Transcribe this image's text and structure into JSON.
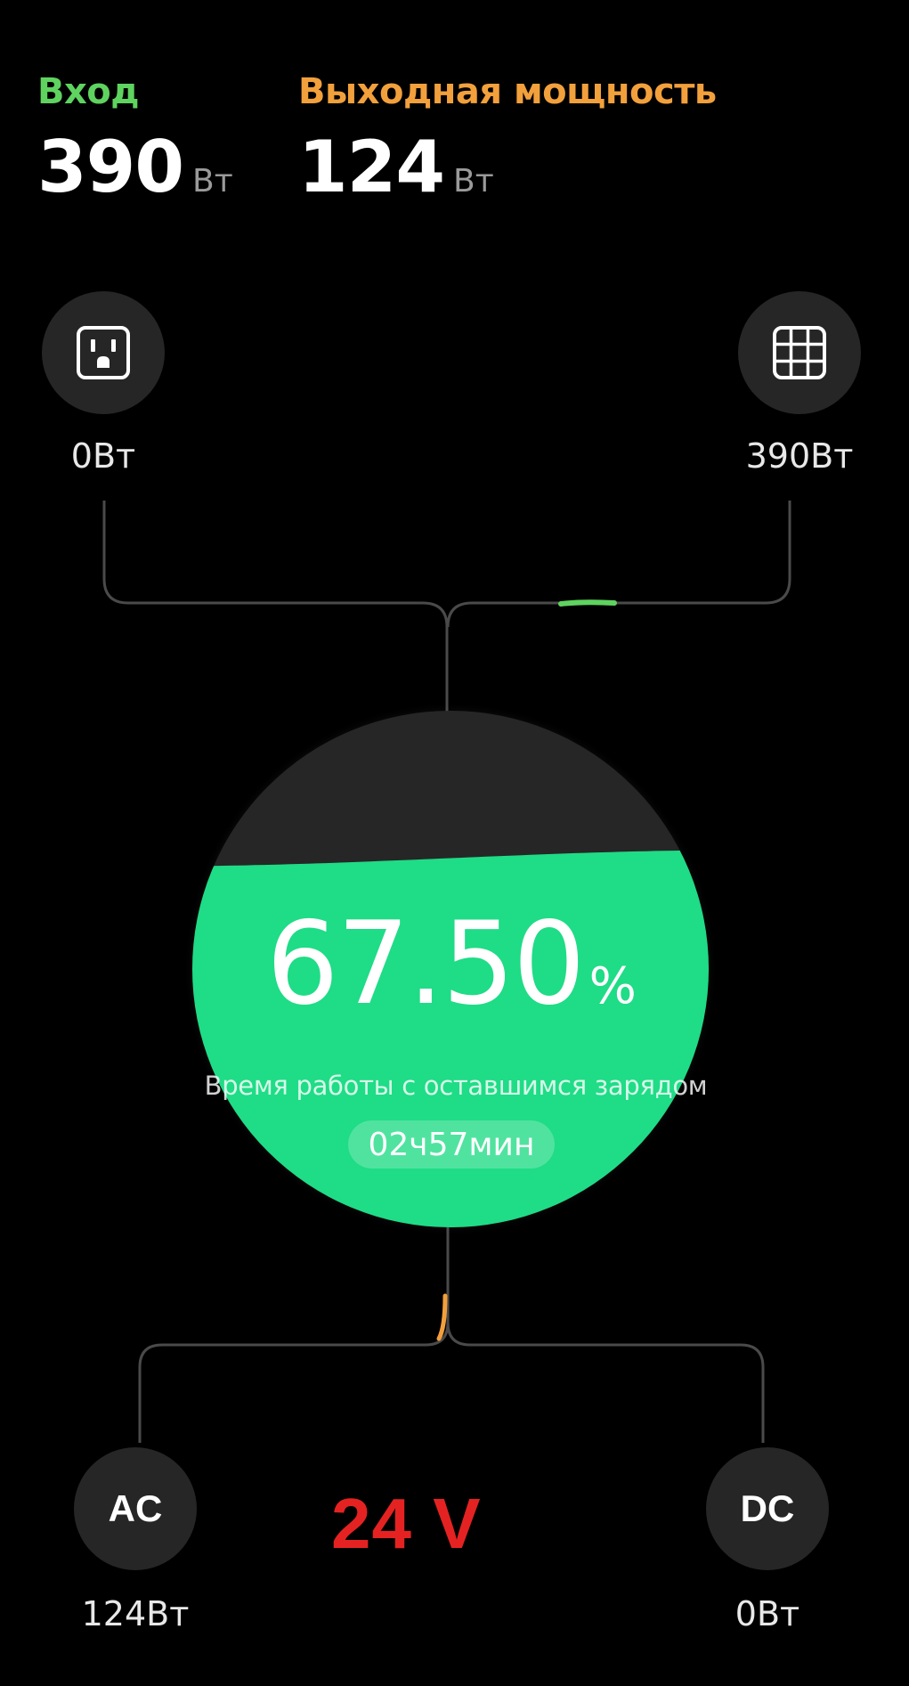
{
  "header": {
    "input_label": "Вход",
    "input_value": "390",
    "input_unit": "Вт",
    "output_label": "Выходная мощность",
    "output_value": "124",
    "output_unit": "Вт"
  },
  "sources": {
    "grid": {
      "icon": "outlet-icon",
      "value": "0Вт"
    },
    "solar": {
      "icon": "solar-panel-icon",
      "value": "390Вт"
    }
  },
  "battery": {
    "percent": "67.50",
    "percent_sign": "%",
    "level": 0.675,
    "runtime_label": "Время работы с оставшимся зарядом",
    "runtime_value": "02ч57мин"
  },
  "outputs": {
    "ac": {
      "label": "AC",
      "value": "124Вт"
    },
    "dc": {
      "label": "DC",
      "value": "0Вт"
    }
  },
  "voltage": "24 V",
  "colors": {
    "input": "#5fd35f",
    "output": "#f2a03c",
    "battery_fill": "#1fdc86",
    "voltage": "#e52222"
  }
}
